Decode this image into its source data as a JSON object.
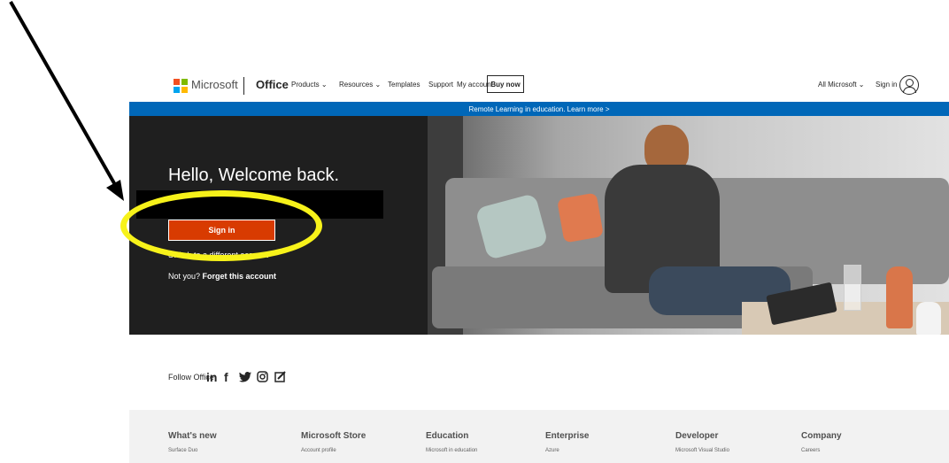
{
  "header": {
    "brand": "Microsoft",
    "product": "Office",
    "nav": [
      {
        "label": "Products",
        "dropdown": true
      },
      {
        "label": "Resources",
        "dropdown": true
      },
      {
        "label": "Templates",
        "dropdown": false
      },
      {
        "label": "Support",
        "dropdown": false
      },
      {
        "label": "My account",
        "dropdown": false
      }
    ],
    "buy_now": "Buy now",
    "all_microsoft": "All Microsoft",
    "sign_in": "Sign in"
  },
  "banner": {
    "text": "Remote Learning in education. Learn more >"
  },
  "hero": {
    "greeting": "Hello, Welcome back.",
    "sign_in_button": "Sign in",
    "switch_account": "Switch to a different account",
    "not_you": "Not you?",
    "forget_account": "Forget this account"
  },
  "follow": {
    "label": "Follow Office",
    "icons": [
      "linkedin-icon",
      "facebook-icon",
      "twitter-icon",
      "instagram-icon",
      "blog-icon"
    ]
  },
  "footer": {
    "columns": [
      {
        "heading": "What's new",
        "first_link": "Surface Duo"
      },
      {
        "heading": "Microsoft Store",
        "first_link": "Account profile"
      },
      {
        "heading": "Education",
        "first_link": "Microsoft in education"
      },
      {
        "heading": "Enterprise",
        "first_link": "Azure"
      },
      {
        "heading": "Developer",
        "first_link": "Microsoft Visual Studio"
      },
      {
        "heading": "Company",
        "first_link": "Careers"
      }
    ]
  },
  "colors": {
    "accent_blue": "#0067b8",
    "sign_in_orange": "#d83b01",
    "highlight_yellow": "#f7f21a",
    "hero_dark": "#1f1f1f",
    "footer_bg": "#f2f2f2"
  }
}
